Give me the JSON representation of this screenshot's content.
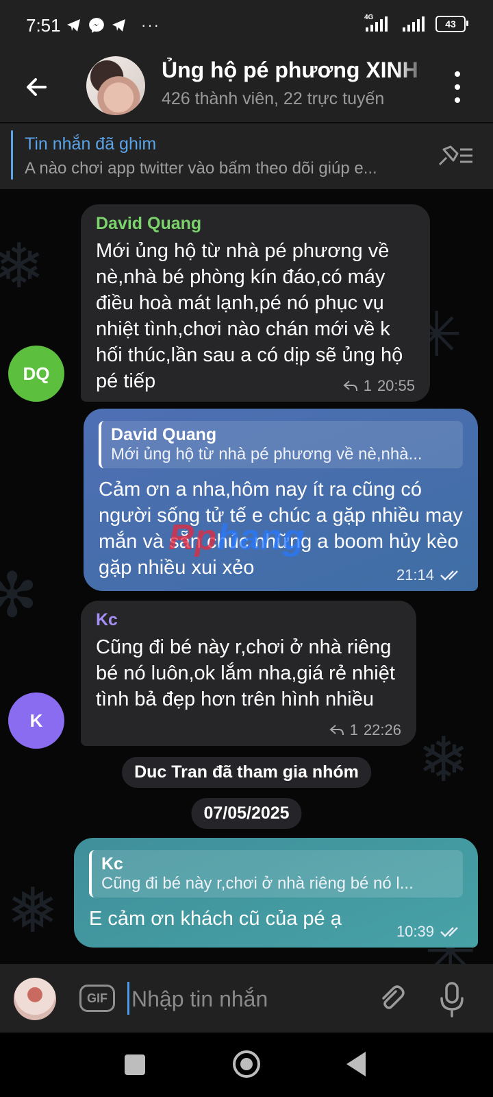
{
  "status_bar": {
    "time": "7:51",
    "network": "4G",
    "battery": "43",
    "more": "···"
  },
  "header": {
    "title": "Ủng hộ pé phương XINH",
    "subtitle": "426 thành viên, 22 trực tuyến"
  },
  "pinned": {
    "title": "Tin nhắn đã ghim",
    "text": "A nào chơi app twitter vào bấm theo dõi giúp e..."
  },
  "messages": [
    {
      "avatar_initials": "DQ",
      "avatar_color": "#5cbf3e",
      "sender": "David Quang",
      "sender_color": "#7bd36b",
      "text": "Mới ủng hộ từ nhà pé phương về nè,nhà bé phòng kín đáo,có máy điều hoà mát lạnh,pé nó phục vụ nhiệt tình,chơi nào chán mới về k hối thúc,lần sau a có dịp sẽ ủng hộ pé tiếp",
      "reply_count": "1",
      "time": "20:55"
    },
    {
      "reply_name": "David Quang",
      "reply_text": "Mới ủng hộ từ nhà pé phương về nè,nhà...",
      "text": "Cảm ơn a nha,hôm nay ít ra cũng có người sống tử tế e chúc a gặp nhiều may mắn và sẵn chúc những a boom hủy kèo gặp nhiều xui xẻo",
      "time": "21:14"
    },
    {
      "avatar_initials": "K",
      "avatar_color": "#8a6cf0",
      "sender": "Kc",
      "sender_color": "#a58ff5",
      "text": "Cũng đi bé này r,chơi ở nhà riêng bé nó luôn,ok lắm nha,giá rẻ nhiệt tình bả đẹp hơn trên hình nhiều",
      "reply_count": "1",
      "time": "22:26"
    },
    {
      "reply_name": "Kc",
      "reply_text": "Cũng đi bé này r,chơi ở nhà riêng bé nó l...",
      "text": "E cảm ơn khách cũ của pé ạ",
      "time": "10:39"
    }
  ],
  "service": {
    "join": "Duc Tran đã tham gia nhóm",
    "date": "07/05/2025"
  },
  "watermark": {
    "part1": "Rp",
    "part2": "hang"
  },
  "input": {
    "placeholder": "Nhập tin nhắn",
    "gif_label": "GIF"
  },
  "colors": {
    "accent": "#5aa3e6",
    "out_bubble_1": "#4a6fb0",
    "out_bubble_2": "#3e8f98"
  }
}
